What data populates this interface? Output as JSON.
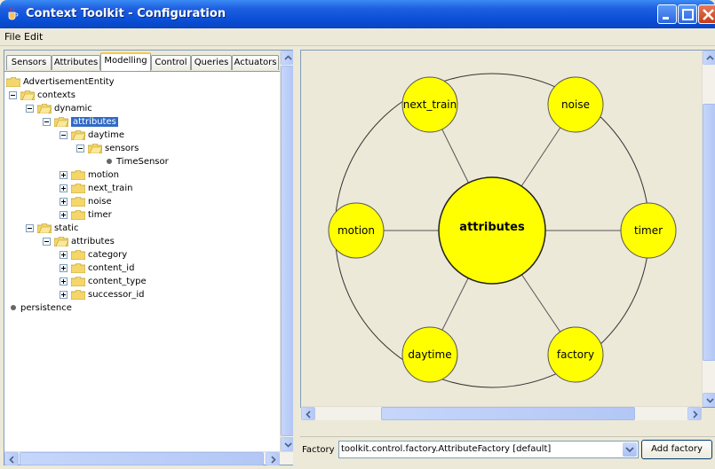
{
  "window": {
    "title": "Context Toolkit - Configuration"
  },
  "menu": [
    "File",
    "Edit"
  ],
  "tabs": [
    "Sensors",
    "Attributes",
    "Modelling",
    "Control",
    "Queries",
    "Actuators"
  ],
  "active_tab": "Modelling",
  "tree": {
    "root": "AdvertisementEntity",
    "contexts": "contexts",
    "dynamic": "dynamic",
    "attributes": "attributes",
    "daytime": "daytime",
    "sensors": "sensors",
    "time_sensor": "TimeSensor",
    "motion": "motion",
    "next_train": "next_train",
    "noise": "noise",
    "timer": "timer",
    "static": "static",
    "static_attributes": "attributes",
    "category": "category",
    "content_id": "content_id",
    "content_type": "content_type",
    "successor_id": "successor_id",
    "persistence": "persistence"
  },
  "graph": {
    "center": "attributes",
    "nodes": {
      "next_train": "next_train",
      "noise": "noise",
      "motion": "motion",
      "timer": "timer",
      "daytime": "daytime",
      "factory": "factory"
    },
    "node_color": "#ffff00",
    "center_color": "#ffff00"
  },
  "factory": {
    "label": "Factory",
    "value": "toolkit.control.factory.AttributeFactory [default]",
    "button": "Add factory"
  },
  "colors": {
    "selection": "#316ac5",
    "titlebar": "#0a4fd6"
  }
}
